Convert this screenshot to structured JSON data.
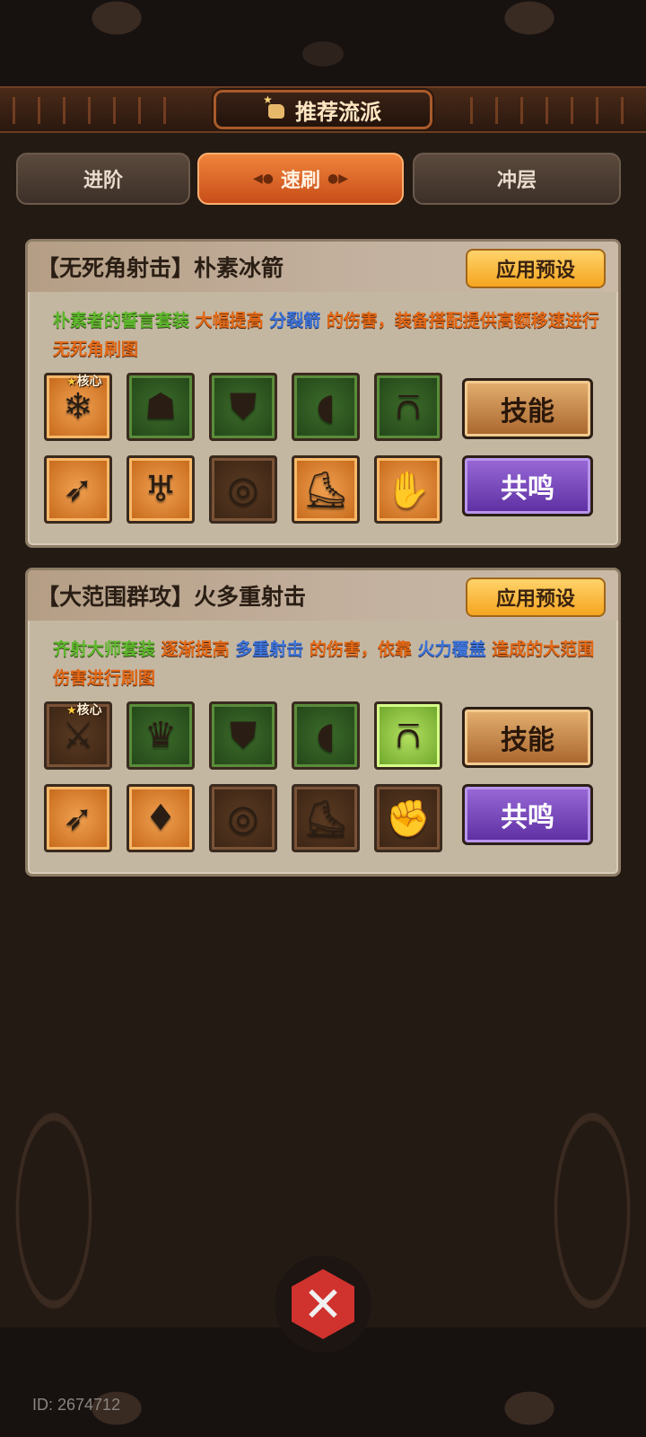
{
  "header": {
    "title": "推荐流派",
    "title_icon": "thumbs-up-icon"
  },
  "tabs": [
    {
      "label": "进阶",
      "active": false
    },
    {
      "label": "速刷",
      "active": true
    },
    {
      "label": "冲层",
      "active": false
    }
  ],
  "builds": [
    {
      "title": "【无死角射击】朴素冰箭",
      "apply_label": "应用预设",
      "desc": {
        "p1": "朴素者的誓言套装",
        "p2": "大幅提高",
        "p3": "分裂箭",
        "p4": "的伤害，装备搭配提供高额移速进行无死角刷图"
      },
      "core_label": "核心",
      "items": [
        {
          "icon": "ice-arrow-skill-icon",
          "glyph": "❄",
          "rarity": "orange"
        },
        {
          "icon": "wolf-helmet-icon",
          "glyph": "☗",
          "rarity": "green"
        },
        {
          "icon": "chest-armor-icon",
          "glyph": "⛊",
          "rarity": "green"
        },
        {
          "icon": "shoulder-armor-icon",
          "glyph": "◖",
          "rarity": "green"
        },
        {
          "icon": "pants-icon",
          "glyph": "⩃",
          "rarity": "green"
        },
        {
          "icon": "quiver-icon",
          "glyph": "➶",
          "rarity": "orange"
        },
        {
          "icon": "wing-amulet-icon",
          "glyph": "♅",
          "rarity": "orange"
        },
        {
          "icon": "purple-ring-icon",
          "glyph": "◎",
          "rarity": "brown"
        },
        {
          "icon": "boots-icon",
          "glyph": "⛸",
          "rarity": "orange"
        },
        {
          "icon": "gloves-icon",
          "glyph": "✋",
          "rarity": "orange"
        }
      ],
      "skill_label": "技能",
      "resonance_label": "共鸣"
    },
    {
      "title": "【大范围群攻】火多重射击",
      "apply_label": "应用预设",
      "desc": {
        "p1": "齐射大师套装",
        "p2": "逐渐提高",
        "p3": "多重射击",
        "p4": "的伤害，依靠",
        "p5": "火力覆盖",
        "p6": "造成的大范围伤害进行刷图"
      },
      "core_label": "核心",
      "items": [
        {
          "icon": "crossbow-skill-icon",
          "glyph": "⚔",
          "rarity": "brown"
        },
        {
          "icon": "spiked-helmet-icon",
          "glyph": "♛",
          "rarity": "green"
        },
        {
          "icon": "leather-chest-icon",
          "glyph": "⛊",
          "rarity": "green"
        },
        {
          "icon": "shoulder-pad-icon",
          "glyph": "◖",
          "rarity": "green"
        },
        {
          "icon": "leg-armor-icon",
          "glyph": "⩃",
          "rarity": "lime"
        },
        {
          "icon": "arrow-quiver-icon",
          "glyph": "➶",
          "rarity": "orange"
        },
        {
          "icon": "gem-necklace-icon",
          "glyph": "♦",
          "rarity": "orange"
        },
        {
          "icon": "purple-ring-icon",
          "glyph": "◎",
          "rarity": "brown"
        },
        {
          "icon": "yellow-boots-icon",
          "glyph": "⛸",
          "rarity": "brown"
        },
        {
          "icon": "leather-glove-icon",
          "glyph": "✊",
          "rarity": "brown"
        }
      ],
      "skill_label": "技能",
      "resonance_label": "共鸣"
    }
  ],
  "close_icon": "close-x-icon",
  "user_id": "ID: 2674712"
}
